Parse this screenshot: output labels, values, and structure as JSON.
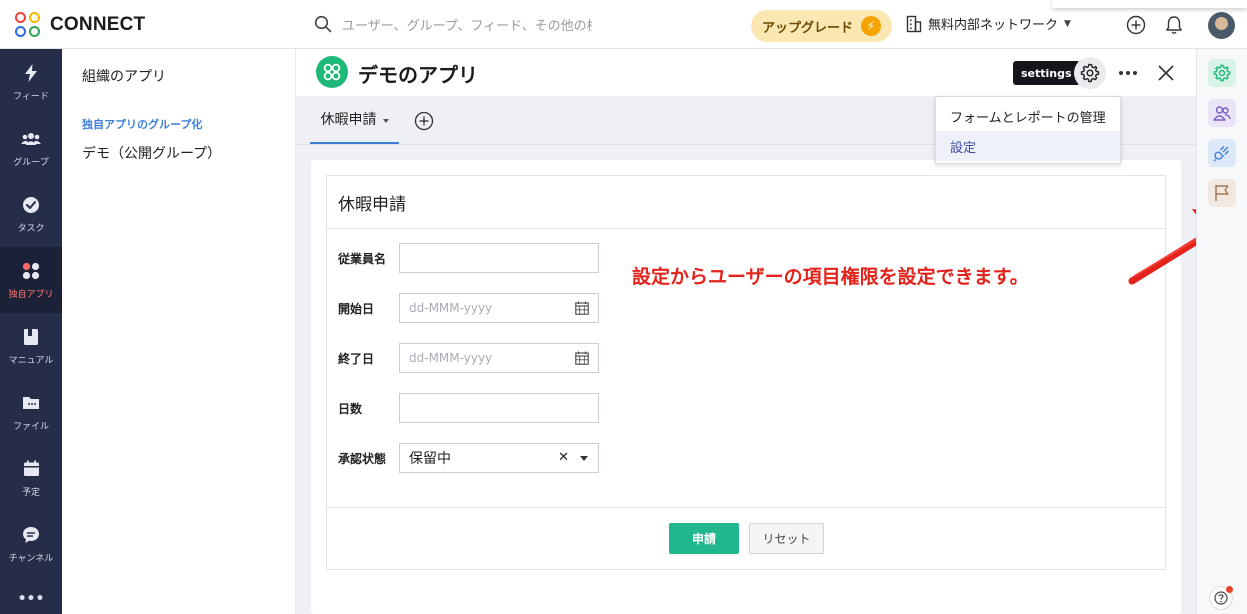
{
  "app": {
    "brand": "CONNECT",
    "logo_colors": [
      "#e8423f",
      "#f7b500",
      "#2ea44f",
      "#2d6ce0"
    ]
  },
  "topbar": {
    "search_placeholder": "ユーザー、グループ、フィード、その他の検索",
    "upgrade_label": "アップグレード",
    "network_label": "無料内部ネットワーク",
    "icons": [
      "search-icon",
      "bolt-icon",
      "building-icon",
      "add-circle-icon",
      "bell-icon",
      "user-avatar"
    ]
  },
  "leftnav": {
    "items": [
      {
        "label": "フィード",
        "icon": "bolt-icon",
        "active": false
      },
      {
        "label": "グループ",
        "icon": "people-icon",
        "active": false
      },
      {
        "label": "タスク",
        "icon": "check-circle-icon",
        "active": false
      },
      {
        "label": "独自アプリ",
        "icon": "apps-icon",
        "active": true
      },
      {
        "label": "マニュアル",
        "icon": "book-icon",
        "active": false
      },
      {
        "label": "ファイル",
        "icon": "folder-icon",
        "active": false
      },
      {
        "label": "予定",
        "icon": "calendar-icon",
        "active": false
      },
      {
        "label": "チャンネル",
        "icon": "chat-icon",
        "active": false
      }
    ],
    "more_label": "•••"
  },
  "subnav": {
    "title": "組織のアプリ",
    "group_heading": "独自アプリのグループ化",
    "item": "デモ（公開グループ）"
  },
  "app_header": {
    "title": "デモのアプリ",
    "tooltip": "settings",
    "icons": [
      "gear-icon",
      "more-icon",
      "close-icon"
    ]
  },
  "tabs": {
    "active_tab": "休暇申請"
  },
  "dropdown": {
    "items": [
      "フォームとレポートの管理",
      "設定"
    ],
    "highlighted": "設定"
  },
  "form": {
    "title": "休暇申請",
    "fields": [
      {
        "label": "従業員名",
        "type": "text",
        "value": "",
        "placeholder": ""
      },
      {
        "label": "開始日",
        "type": "date",
        "value": "",
        "placeholder": "dd-MMM-yyyy"
      },
      {
        "label": "終了日",
        "type": "date",
        "value": "",
        "placeholder": "dd-MMM-yyyy"
      },
      {
        "label": "日数",
        "type": "text",
        "value": "",
        "placeholder": ""
      },
      {
        "label": "承認状態",
        "type": "select",
        "value": "保留中",
        "placeholder": ""
      }
    ],
    "submit_label": "申請",
    "reset_label": "リセット"
  },
  "annotation": {
    "text": "設定からユーザーの項目権限を設定できます。",
    "color": "#e3231b"
  },
  "rightrail": {
    "icons": [
      "gear-icon",
      "people-icon",
      "plug-icon",
      "flag-icon",
      "help-icon"
    ],
    "colors": [
      "#1db87a",
      "#7a5cc7",
      "#3d7fd8",
      "#a0785a"
    ]
  }
}
